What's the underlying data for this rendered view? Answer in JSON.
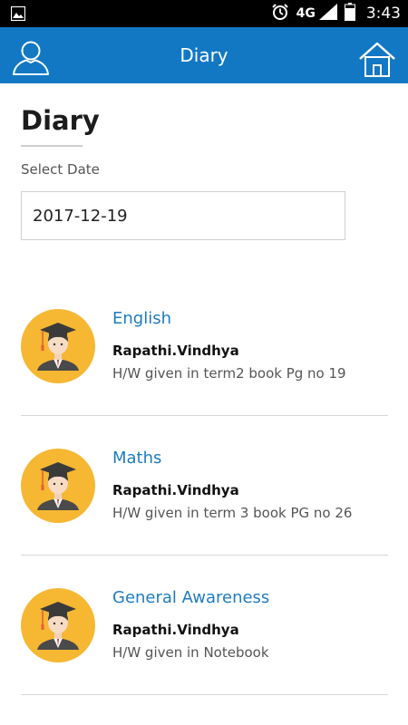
{
  "status_bar": {
    "network": "4G",
    "time": "3:43",
    "icons": [
      "image-icon",
      "alarm-icon",
      "signal-icon",
      "battery-icon"
    ]
  },
  "app_bar": {
    "title": "Diary",
    "background": "#1378c3",
    "left_icon": "profile-icon",
    "right_icon": "home-icon"
  },
  "page": {
    "title": "Diary",
    "date_label": "Select Date",
    "date_value": "2017-12-19"
  },
  "entries": [
    {
      "subject": "English",
      "teacher": "Rapathi.Vindhya",
      "description": "H/W given in term2 book Pg no 19",
      "avatar": "graduate-avatar-icon"
    },
    {
      "subject": "Maths",
      "teacher": "Rapathi.Vindhya",
      "description": "H/W given in term 3 book PG no 26",
      "avatar": "graduate-avatar-icon"
    },
    {
      "subject": "General Awareness",
      "teacher": "Rapathi.Vindhya",
      "description": "H/W given in Notebook",
      "avatar": "graduate-avatar-icon"
    }
  ],
  "colors": {
    "accent": "#1378c3",
    "subject_text": "#1e7cc0",
    "avatar_bg": "#f6b732"
  }
}
